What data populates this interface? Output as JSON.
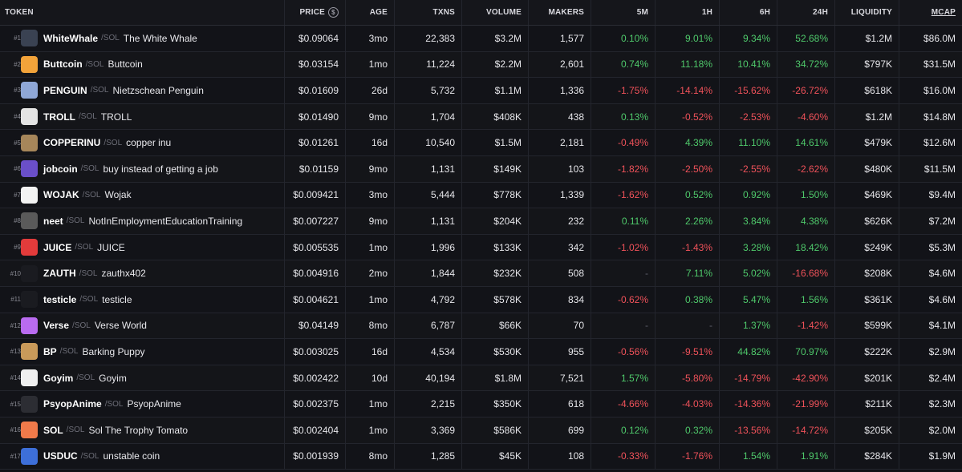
{
  "headers": {
    "token": "TOKEN",
    "price": "PRICE",
    "age": "AGE",
    "txns": "TXNS",
    "volume": "VOLUME",
    "makers": "MAKERS",
    "m5": "5M",
    "h1": "1H",
    "h6": "6H",
    "h24": "24H",
    "liquidity": "LIQUIDITY",
    "mcap": "MCAP"
  },
  "price_currency_symbol": "$",
  "colors": {
    "positive": "#4fc96b",
    "negative": "#f0525a",
    "background": "#121318"
  },
  "rows": [
    {
      "rank": "#1",
      "symbol": "WhiteWhale",
      "chain": "/SOL",
      "name": "The White Whale",
      "price": "$0.09064",
      "age": "3mo",
      "txns": "22,383",
      "volume": "$3.2M",
      "makers": "1,577",
      "m5": "0.10%",
      "h1": "9.01%",
      "h6": "9.34%",
      "h24": "52.68%",
      "liquidity": "$1.2M",
      "mcap": "$86.0M",
      "icon": "whale-icon",
      "avatar_color": "#3a4252"
    },
    {
      "rank": "#2",
      "symbol": "Buttcoin",
      "chain": "/SOL",
      "name": "Buttcoin",
      "price": "$0.03154",
      "age": "1mo",
      "txns": "11,224",
      "volume": "$2.2M",
      "makers": "2,601",
      "m5": "0.74%",
      "h1": "11.18%",
      "h6": "10.41%",
      "h24": "34.72%",
      "liquidity": "$797K",
      "mcap": "$31.5M",
      "icon": "buttcoin-icon",
      "avatar_color": "#f2a33a"
    },
    {
      "rank": "#3",
      "symbol": "PENGUIN",
      "chain": "/SOL",
      "name": "Nietzschean Penguin",
      "price": "$0.01609",
      "age": "26d",
      "txns": "5,732",
      "volume": "$1.1M",
      "makers": "1,336",
      "m5": "-1.75%",
      "h1": "-14.14%",
      "h6": "-15.62%",
      "h24": "-26.72%",
      "liquidity": "$618K",
      "mcap": "$16.0M",
      "icon": "penguin-icon",
      "avatar_color": "#8fa7d6"
    },
    {
      "rank": "#4",
      "symbol": "TROLL",
      "chain": "/SOL",
      "name": "TROLL",
      "price": "$0.01490",
      "age": "9mo",
      "txns": "1,704",
      "volume": "$408K",
      "makers": "438",
      "m5": "0.13%",
      "h1": "-0.52%",
      "h6": "-2.53%",
      "h24": "-4.60%",
      "liquidity": "$1.2M",
      "mcap": "$14.8M",
      "icon": "trollface-icon",
      "avatar_color": "#e4e4e4"
    },
    {
      "rank": "#5",
      "symbol": "COPPERINU",
      "chain": "/SOL",
      "name": "copper inu",
      "price": "$0.01261",
      "age": "16d",
      "txns": "10,540",
      "volume": "$1.5M",
      "makers": "2,181",
      "m5": "-0.49%",
      "h1": "4.39%",
      "h6": "11.10%",
      "h24": "14.61%",
      "liquidity": "$479K",
      "mcap": "$12.6M",
      "icon": "dog-icon",
      "avatar_color": "#a6865a"
    },
    {
      "rank": "#6",
      "symbol": "jobcoin",
      "chain": "/SOL",
      "name": "buy instead of getting a job",
      "price": "$0.01159",
      "age": "9mo",
      "txns": "1,131",
      "volume": "$149K",
      "makers": "103",
      "m5": "-1.82%",
      "h1": "-2.50%",
      "h6": "-2.55%",
      "h24": "-2.62%",
      "liquidity": "$480K",
      "mcap": "$11.5M",
      "icon": "jobcoin-icon",
      "avatar_color": "#6a4fc9"
    },
    {
      "rank": "#7",
      "symbol": "WOJAK",
      "chain": "/SOL",
      "name": "Wojak",
      "price": "$0.009421",
      "age": "3mo",
      "txns": "5,444",
      "volume": "$778K",
      "makers": "1,339",
      "m5": "-1.62%",
      "h1": "0.52%",
      "h6": "0.92%",
      "h24": "1.50%",
      "liquidity": "$469K",
      "mcap": "$9.4M",
      "icon": "wojak-icon",
      "avatar_color": "#f3f3f3"
    },
    {
      "rank": "#8",
      "symbol": "neet",
      "chain": "/SOL",
      "name": "NotInEmploymentEducationTraining",
      "price": "$0.007227",
      "age": "9mo",
      "txns": "1,131",
      "volume": "$204K",
      "makers": "232",
      "m5": "0.11%",
      "h1": "2.26%",
      "h6": "3.84%",
      "h24": "4.38%",
      "liquidity": "$626K",
      "mcap": "$7.2M",
      "icon": "neet-icon",
      "avatar_color": "#5a5a5a"
    },
    {
      "rank": "#9",
      "symbol": "JUICE",
      "chain": "/SOL",
      "name": "JUICE",
      "price": "$0.005535",
      "age": "1mo",
      "txns": "1,996",
      "volume": "$133K",
      "makers": "342",
      "m5": "-1.02%",
      "h1": "-1.43%",
      "h6": "3.28%",
      "h24": "18.42%",
      "liquidity": "$249K",
      "mcap": "$5.3M",
      "icon": "juice-box-icon",
      "avatar_color": "#e33b3b"
    },
    {
      "rank": "#10",
      "symbol": "ZAUTH",
      "chain": "/SOL",
      "name": "zauthx402",
      "price": "$0.004916",
      "age": "2mo",
      "txns": "1,844",
      "volume": "$232K",
      "makers": "508",
      "m5": "-",
      "h1": "7.11%",
      "h6": "5.02%",
      "h24": "-16.68%",
      "liquidity": "$208K",
      "mcap": "$4.6M",
      "icon": "z-logo-icon",
      "avatar_color": "#1a1b20"
    },
    {
      "rank": "#11",
      "symbol": "testicle",
      "chain": "/SOL",
      "name": "testicle",
      "price": "$0.004621",
      "age": "1mo",
      "txns": "4,792",
      "volume": "$578K",
      "makers": "834",
      "m5": "-0.62%",
      "h1": "0.38%",
      "h6": "5.47%",
      "h24": "1.56%",
      "liquidity": "$361K",
      "mcap": "$4.6M",
      "icon": "ring-icon",
      "avatar_color": "#1a1b20"
    },
    {
      "rank": "#12",
      "symbol": "Verse",
      "chain": "/SOL",
      "name": "Verse World",
      "price": "$0.04149",
      "age": "8mo",
      "txns": "6,787",
      "volume": "$66K",
      "makers": "70",
      "m5": "-",
      "h1": "-",
      "h6": "1.37%",
      "h24": "-1.42%",
      "liquidity": "$599K",
      "mcap": "$4.1M",
      "icon": "verse-flower-icon",
      "avatar_color": "#b96bf0"
    },
    {
      "rank": "#13",
      "symbol": "BP",
      "chain": "/SOL",
      "name": "Barking Puppy",
      "price": "$0.003025",
      "age": "16d",
      "txns": "4,534",
      "volume": "$530K",
      "makers": "955",
      "m5": "-0.56%",
      "h1": "-9.51%",
      "h6": "44.82%",
      "h24": "70.97%",
      "liquidity": "$222K",
      "mcap": "$2.9M",
      "icon": "puppy-icon",
      "avatar_color": "#c99a5a"
    },
    {
      "rank": "#14",
      "symbol": "Goyim",
      "chain": "/SOL",
      "name": "Goyim",
      "price": "$0.002422",
      "age": "10d",
      "txns": "40,194",
      "volume": "$1.8M",
      "makers": "7,521",
      "m5": "1.57%",
      "h1": "-5.80%",
      "h6": "-14.79%",
      "h24": "-42.90%",
      "liquidity": "$201K",
      "mcap": "$2.4M",
      "icon": "goyim-icon",
      "avatar_color": "#efefef"
    },
    {
      "rank": "#15",
      "symbol": "PsyopAnime",
      "chain": "/SOL",
      "name": "PsyopAnime",
      "price": "$0.002375",
      "age": "1mo",
      "txns": "2,215",
      "volume": "$350K",
      "makers": "618",
      "m5": "-4.66%",
      "h1": "-4.03%",
      "h6": "-14.36%",
      "h24": "-21.99%",
      "liquidity": "$211K",
      "mcap": "$2.3M",
      "icon": "anime-icon",
      "avatar_color": "#2c2d33"
    },
    {
      "rank": "#16",
      "symbol": "SOL",
      "chain": "/SOL",
      "name": "Sol The Trophy Tomato",
      "price": "$0.002404",
      "age": "1mo",
      "txns": "3,369",
      "volume": "$586K",
      "makers": "699",
      "m5": "0.12%",
      "h1": "0.32%",
      "h6": "-13.56%",
      "h24": "-14.72%",
      "liquidity": "$205K",
      "mcap": "$2.0M",
      "icon": "tomato-icon",
      "avatar_color": "#f07a4a"
    },
    {
      "rank": "#17",
      "symbol": "USDUC",
      "chain": "/SOL",
      "name": "unstable coin",
      "price": "$0.001939",
      "age": "8mo",
      "txns": "1,285",
      "volume": "$45K",
      "makers": "108",
      "m5": "-0.33%",
      "h1": "-1.76%",
      "h6": "1.54%",
      "h24": "1.91%",
      "liquidity": "$284K",
      "mcap": "$1.9M",
      "icon": "wave-coin-icon",
      "avatar_color": "#3d6fd9"
    }
  ]
}
